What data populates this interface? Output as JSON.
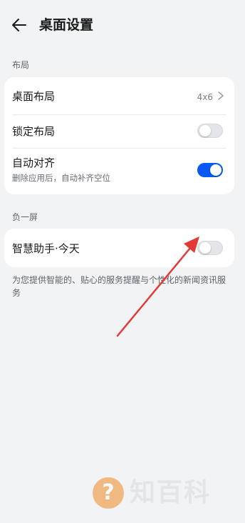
{
  "header": {
    "title": "桌面设置",
    "back_icon": "arrow-left-icon"
  },
  "sections": {
    "layout": {
      "label": "布局",
      "rows": {
        "desktop_layout": {
          "title": "桌面布局",
          "value": "4x6",
          "icon": "chevron-right-icon"
        },
        "lock_layout": {
          "title": "锁定布局",
          "toggle": false
        },
        "auto_align": {
          "title": "自动对齐",
          "subtitle": "删除应用后，自动补齐空位",
          "toggle": true
        }
      }
    },
    "minus_one_screen": {
      "label": "负一屏",
      "rows": {
        "smart_assistant": {
          "title": "智慧助手·今天",
          "toggle": false
        }
      },
      "description": "为您提供智能的、贴心的服务提醒与个性化的新闻资讯服务"
    }
  },
  "watermark": {
    "text": "知百科",
    "icon": "question-circle-icon",
    "color": "#f08a24"
  },
  "colors": {
    "accent": "#0a59f7",
    "annotation_arrow": "#e53935",
    "background": "#f1f3f5"
  }
}
